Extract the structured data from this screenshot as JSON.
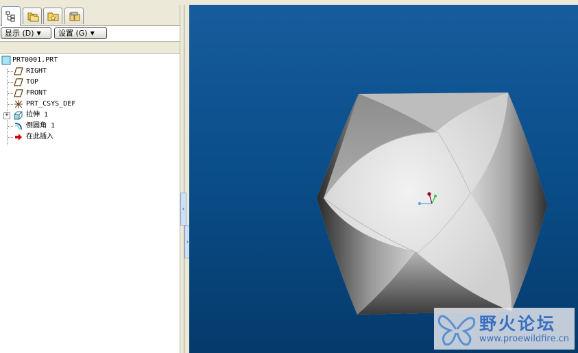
{
  "tabs": [
    {
      "icon": "model-tree-icon",
      "active": true
    },
    {
      "icon": "folder-browser-icon",
      "active": false
    },
    {
      "icon": "favorites-icon",
      "active": false
    },
    {
      "icon": "connections-icon",
      "active": false
    }
  ],
  "toolbar": {
    "show_label": "显示 (D)",
    "settings_label": "设置 (G)"
  },
  "tree": {
    "root": {
      "label": "PRT0001.PRT",
      "icon": "part-icon"
    },
    "items": [
      {
        "label": "RIGHT",
        "icon": "datum-plane-icon"
      },
      {
        "label": "TOP",
        "icon": "datum-plane-icon"
      },
      {
        "label": "FRONT",
        "icon": "datum-plane-icon"
      },
      {
        "label": "PRT_CSYS_DEF",
        "icon": "csys-icon"
      },
      {
        "label": "拉伸 1",
        "icon": "extrude-icon",
        "expandable": true
      },
      {
        "label": "倒圆角 1",
        "icon": "round-icon"
      },
      {
        "label": "在此插入",
        "icon": "insert-here-arrow-icon"
      }
    ]
  },
  "watermark": {
    "title": "野火论坛",
    "url": "www.proewildfire.cn"
  },
  "colors": {
    "viewport_top": "#175c9c",
    "viewport_bottom": "#053a6b",
    "insert_arrow": "#d40000"
  }
}
